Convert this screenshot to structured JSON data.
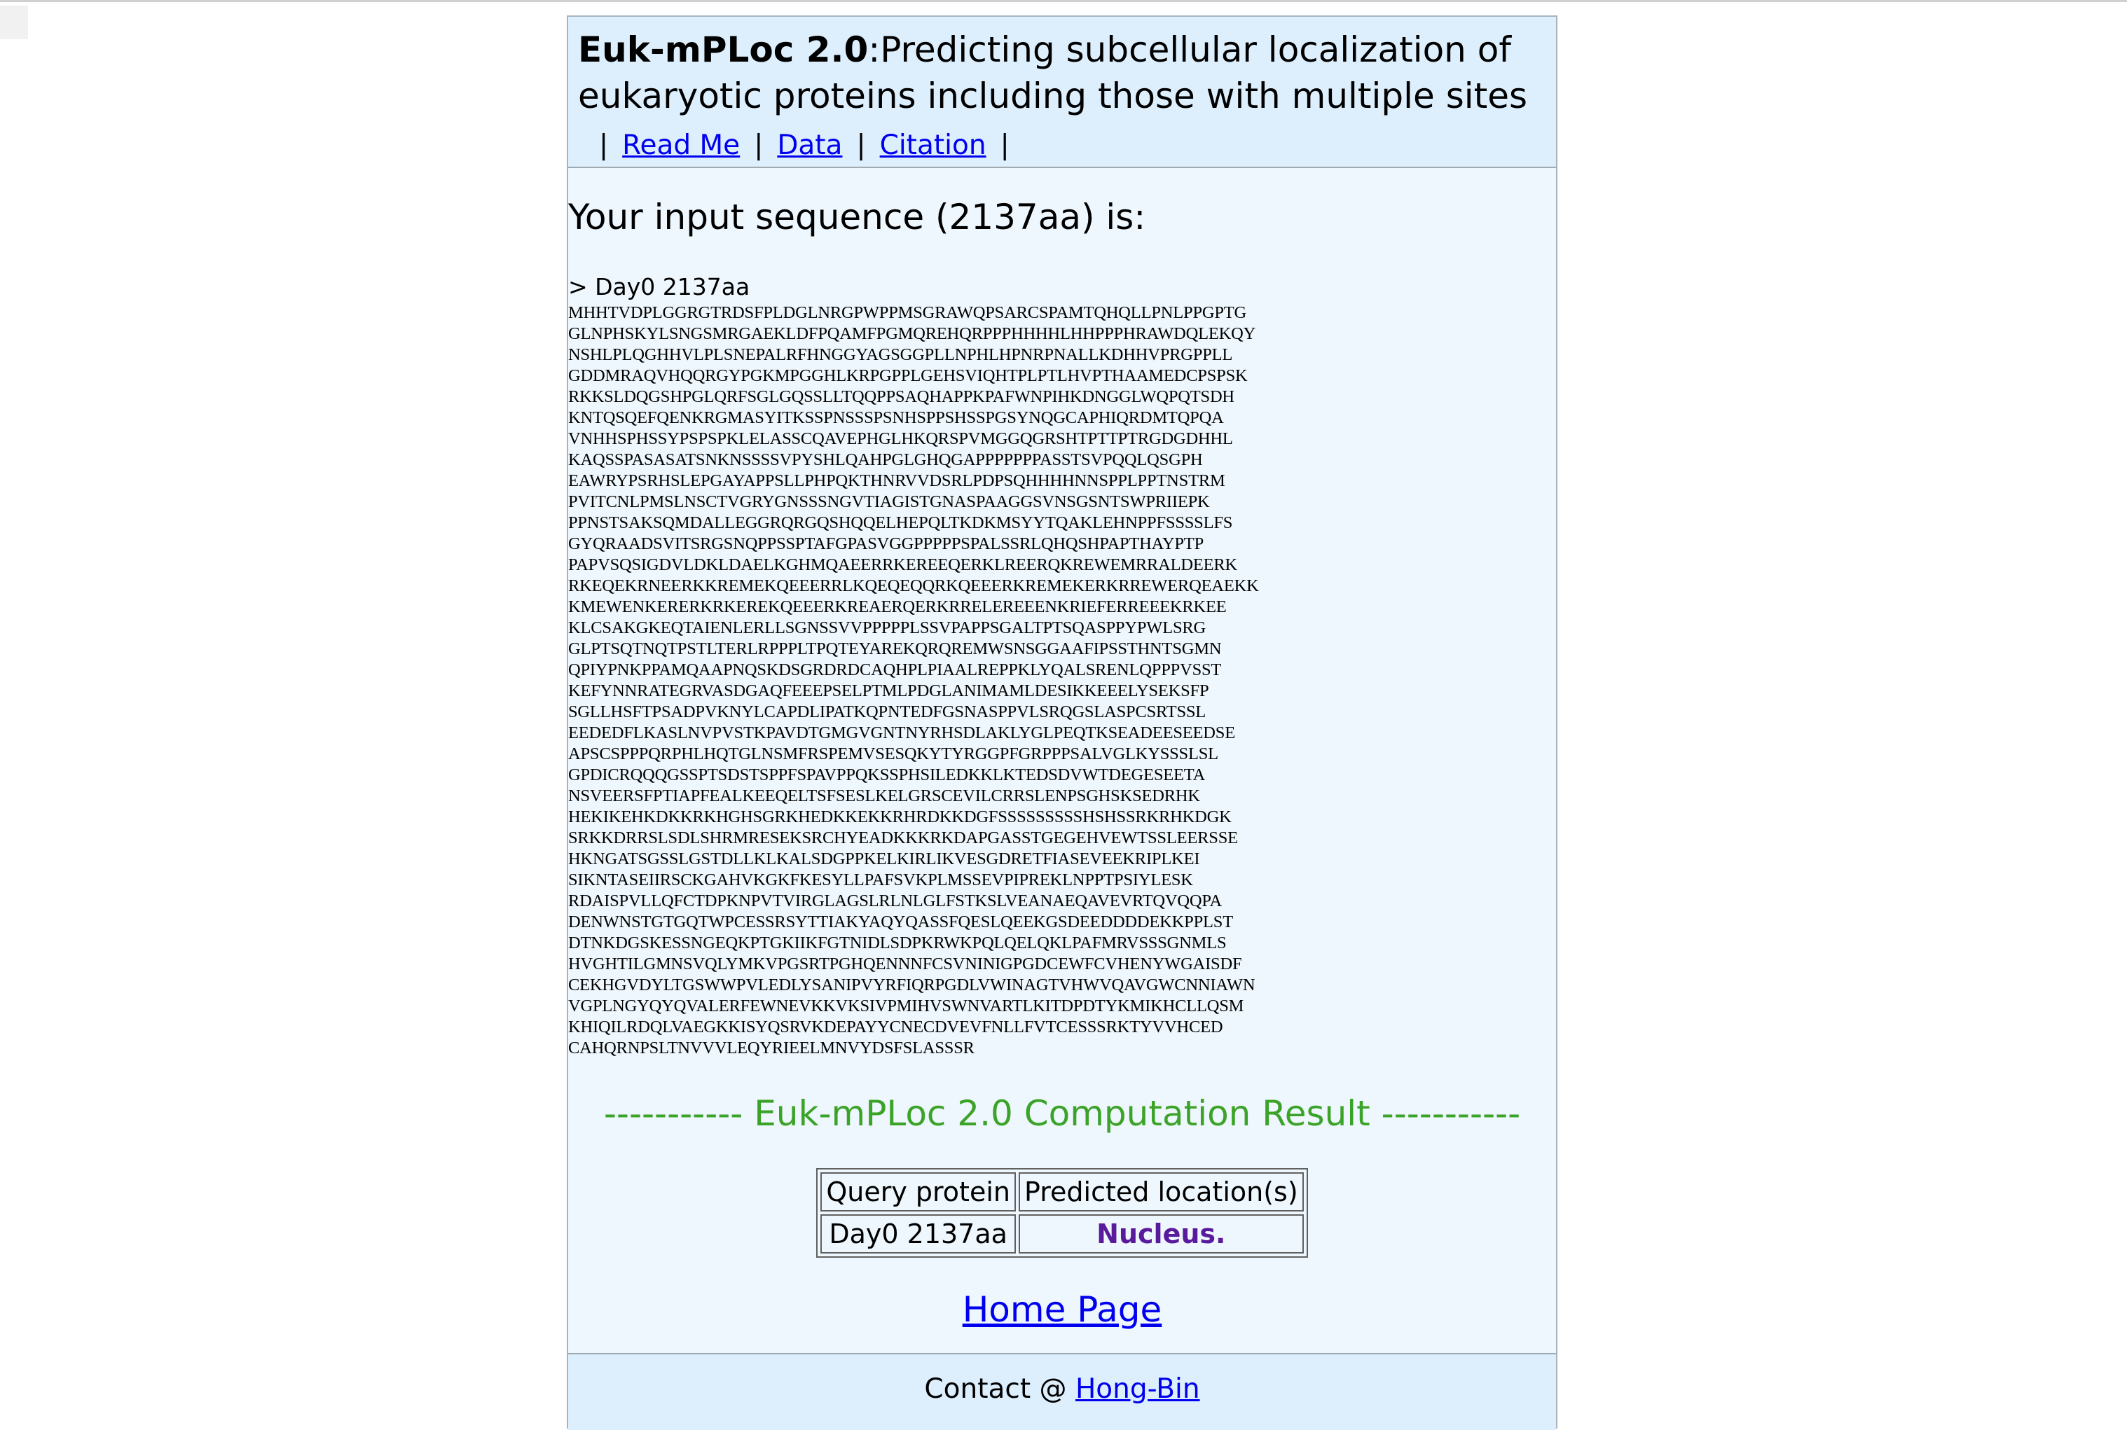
{
  "header": {
    "brand": "Euk-mPLoc 2.0",
    "title_rest": ":Predicting subcellular localization of eukaryotic proteins including those with multiple sites",
    "nav": [
      "Read Me",
      "Data",
      "Citation"
    ]
  },
  "input": {
    "title": "Your input sequence (2137aa) is:",
    "header_line": "> Day0 2137aa",
    "sequence_lines": [
      "MHHTVDPLGGRGTRDSFPLDGLNRGPWPPMSGRAWQPSARCSPAMTQHQLLPNLPPGPTG",
      "GLNPHSKYLSNGSMRGAEKLDFPQAMFPGMQREHQRPPPHHHHLHHPPPHRAWDQLEKQY",
      "NSHLPLQGHHVLPLSNEPALRFHNGGYAGSGGPLLNPHLHPNRPNALLKDHHVPRGPPLL",
      "GDDMRAQVHQQRGYPGKMPGGHLKRPGPPLGEHSVIQHTPLPTLHVPTHAAMEDCPSPSK",
      "RKKSLDQGSHPGLQRFSGLGQSSLLTQQPPSAQHAPPKPAFWNPIHKDNGGLWQPQTSDH",
      "KNTQSQEFQENKRGMASYITKSSPNSSSPSNHSPPSHSSPGSYNQGCAPHIQRDMTQPQA",
      "VNHHSPHSSYPSPSPKLELASSCQAVEPHGLHKQRSPVMGGQGRSHTPTTPTRGDGDHHL",
      "KAQSSPASASATSNKNSSSSVPYSHLQAHPGLGHQGAPPPPPPPASSTSVPQQLQSGPH",
      "EAWRYPSRHSLEPGAYAPPSLLPHPQKTHNRVVDSRLPDPSQHHHHNNSPPLPPTNSTRM",
      "PVITCNLPMSLNSCTVGRYGNSSSNGVTIAGISTGNASPAAGGSVNSGSNTSWPRIIEPK",
      "PPNSTSAKSQMDALLEGGRQRGQSHQQELHEPQLTKDKMSYYTQAKLEHNPPFSSSSLFS",
      "GYQRAADSVITSRGSNQPPSSPTAFGPASVGGPPPPPSPALSSRLQHQSHPAPTHAYPTP",
      "PAPVSQSIGDVLDKLDAELKGHMQAEERRKEREEQERKLREERQKREWEMRRALDEERK",
      "RKEQEKRNEERKKREMEKQEEERRLKQEQEQQRKQEEERKREMEKERKRREWERQEAEKK",
      "KMEWENKERERKRKEREKQEEERKREAERQERKRRELEREEENKRIEFERREEEKRKEE",
      "KLCSAKGKEQTAIENLERLLSGNSSVVPPPPPLSSVPAPPSGALTPTSQASPPYPWLSRG",
      "GLPTSQTNQTPSTLTERLRPPPLTPQTEYAREKQRQREMWSNSGGAAFIPSSTHNTSGMN",
      "QPIYPNKPPAMQAAPNQSKDSGRDRDCAQHPLPIAALREPPKLYQALSRENLQPPPVSST",
      "KEFYNNRATEGRVASDGAQFEEEPSELPTMLPDGLANIMAMLDESIKKEEELYSEKSFP",
      "SGLLHSFTPSADPVKNYLCAPDLIPATKQPNTEDFGSNASPPVLSRQGSLASPCSRTSSL",
      "EEDEDFLKASLNVPVSTKPAVDTGMGVGNTNYRHSDLAKLYGLPEQTKSEADEESEEDSE",
      "APSCSPPPQRPHLHQTGLNSMFRSPEMVSESQKYTYRGGPFGRPPPSALVGLKYSSSLSL",
      "GPDICRQQQGSSPTSDSTSPPFSPAVPPQKSSPHSILEDKKLKTEDSDVWTDEGESEETA",
      "NSVEERSFPTIAPFEALKEEQELTSFSESLKELGRSCEVILCRRSLENPSGHSKSEDRHK",
      "HEKIKEHKDKKRKHGHSGRKHEDKKEKKRHRDKKDGFSSSSSSSSSHSHSSRKRHKDGK",
      "SRKKDRRSLSDLSHRMRESEKSRCHYEADKKKRKDAPGASSTGEGEHVEWTSSLEERSSE",
      "HKNGATSGSSLGSTDLLKLKALSDGPPKELKIRLIKVESGDRETFIASEVEEKRIPLKEI",
      "SIKNTASEIIRSCKGAHVKGKFKESYLLPAFSVKPLMSSEVPIPREKLNPPTPSIYLESK",
      "RDAISPVLLQFCTDPKNPVTVIRGLAGSLRLNLGLFSTKSLVEANAEQAVEVRTQVQQPA",
      "DENWNSTGTGQTWPCESSRSYTTIAKYAQYQASSFQESLQEEKGSDEEDDDDEKKPPLST",
      "DTNKDGSKESSNGEQKPTGKIIKFGTNIDLSDPKRWKPQLQELQKLPAFMRVSSSGNMLS",
      "HVGHTILGMNSVQLYMKVPGSRTPGHQENNNFCSVNINIGPGDCEWFCVHENYWGAISDF",
      "CEKHGVDYLTGSWWPVLEDLYSANIPVYRFIQRPGDLVWINAGTVHWVQAVGWCNNIAWN",
      "VGPLNGYQYQVALERFEWNEVKKVKSIVPMIHVSWNVARTLKITDPDTYKMIKHCLLQSM",
      "KHIQILRDQLVAEGKKISYQSRVKDEPAYYCNECDVEVFNLLFVTCESSSRKTYVVHCED",
      "CAHQRNPSLTNVVVLEQYRIEELMNVYDSFSLASSSR"
    ]
  },
  "result": {
    "title": "----------- Euk-mPLoc 2.0 Computation Result -----------",
    "col_query": "Query protein",
    "col_location": "Predicted location(s)",
    "query": "Day0 2137aa",
    "location": "Nucleus.",
    "location_color": "#5a1a9c"
  },
  "home_link": "Home Page",
  "footer": {
    "prefix": "Contact @ ",
    "link": "Hong-Bin"
  }
}
